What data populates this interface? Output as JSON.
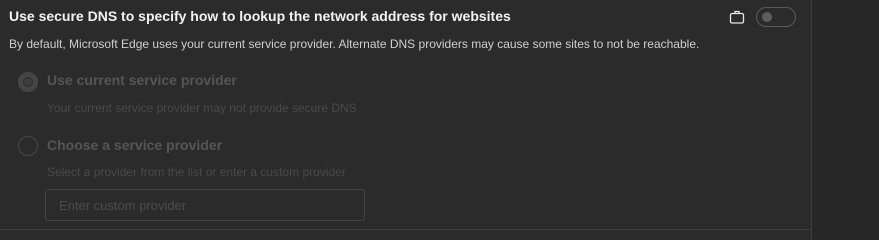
{
  "setting": {
    "title": "Use secure DNS to specify how to lookup the network address for websites",
    "description": "By default, Microsoft Edge uses your current service provider. Alternate DNS providers may cause some sites to not be reachable.",
    "policy_icon": "briefcase-icon",
    "toggle_state": "off",
    "disabled": true
  },
  "options": [
    {
      "label": "Use current service provider",
      "sublabel": "Your current service provider may not provide secure DNS",
      "selected": true
    },
    {
      "label": "Choose a service provider",
      "sublabel": "Select a provider from the list or enter a custom provider",
      "selected": false
    }
  ],
  "custom_provider": {
    "value": "",
    "placeholder": "Enter custom provider"
  }
}
